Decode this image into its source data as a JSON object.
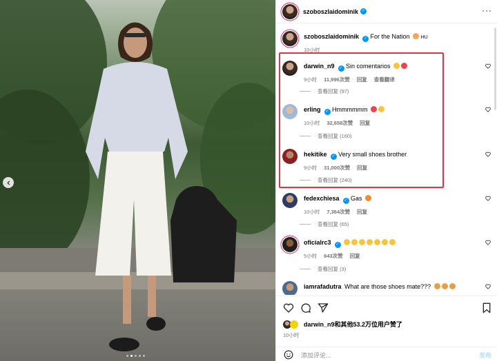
{
  "post": {
    "author": "szoboszlaidominik",
    "caption_text": "For the Nation",
    "caption_suffix": "HU",
    "caption_time": "10小时",
    "more_icon": "more-horizontal-icon"
  },
  "comments": [
    {
      "user": "darwin_n9",
      "text": "Sin comentarios",
      "emojis": [
        "#f5c542",
        "#e8454f"
      ],
      "time": "9小时",
      "likes": "11,996次赞",
      "reply": "回复",
      "extra": "查看翻译",
      "replies": "查看回复 (97)"
    },
    {
      "user": "erling",
      "text": "Hmmmmmm",
      "emojis": [
        "#e8454f",
        "#f5c542"
      ],
      "time": "10小时",
      "likes": "32,658次赞",
      "reply": "回复",
      "extra": "",
      "replies": "查看回复 (160)"
    },
    {
      "user": "hekitike",
      "text": "Very small shoes brother",
      "emojis": [],
      "time": "9小时",
      "likes": "31,000次赞",
      "reply": "回复",
      "extra": "",
      "replies": "查看回复 (240)"
    },
    {
      "user": "fedexchiesa",
      "text": "Gas",
      "emojis": [
        "#f28a2e"
      ],
      "time": "10小时",
      "likes": "7,364次赞",
      "reply": "回复",
      "extra": "",
      "replies": "查看回复 (65)"
    },
    {
      "user": "oficialrc3",
      "text": "",
      "emojis": [
        "#f5c542",
        "#f5c542",
        "#f5c542",
        "#f5c542",
        "#f5c542",
        "#f5c542",
        "#f5c542"
      ],
      "time": "5小时",
      "likes": "643次赞",
      "reply": "回复",
      "extra": "",
      "replies": "查看回复 (3)"
    },
    {
      "user": "iamrafadutra",
      "text": "What are those shoes mate???",
      "emojis": [
        "#e3a04a",
        "#e3a04a",
        "#e3a04a"
      ],
      "time": "",
      "likes": "",
      "reply": "",
      "extra": "",
      "replies": ""
    }
  ],
  "actions": {
    "like_icon": "heart-icon",
    "comment_icon": "comment-icon",
    "share_icon": "share-icon",
    "save_icon": "bookmark-icon"
  },
  "likes_summary": {
    "user": "darwin_n9",
    "text": "和其他53.2万位用户赞了"
  },
  "post_time": "10小时",
  "composer": {
    "placeholder": "添加评论...",
    "post_label": "发布"
  },
  "carousel": {
    "total": 5,
    "active": 2
  },
  "colors": {
    "verified": "#0095f6",
    "highlight": "#e8303f",
    "meta": "#737373",
    "post_button": "#b2dffc"
  }
}
